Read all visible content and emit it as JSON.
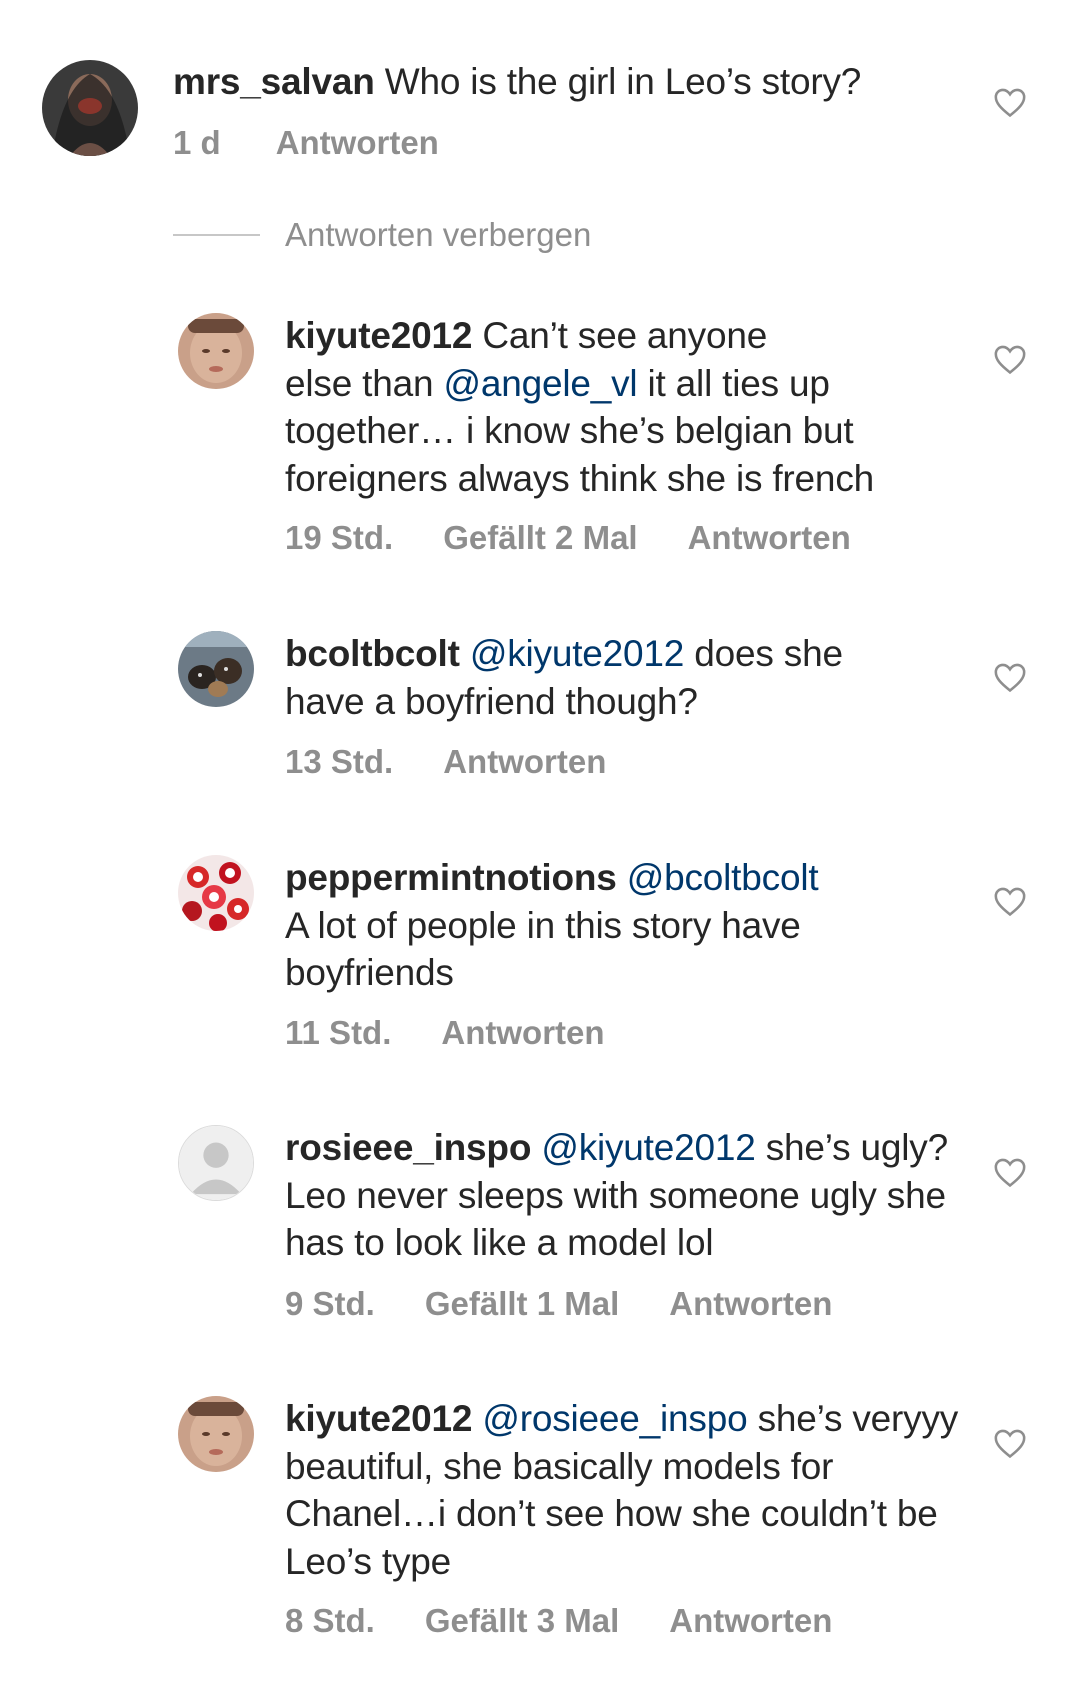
{
  "top_comment": {
    "user": "mrs_salvan",
    "text": " Who is the girl in Leo’s story?",
    "time": "1 d",
    "reply": "Antworten"
  },
  "hide_replies": "Antworten verbergen",
  "replies": [
    {
      "user": "kiyute2012",
      "text_1": " Can’t see anyone",
      "text_2": "else than ",
      "mention": "@angele_vl",
      "text_3": " it all ties up together… i know she’s belgian but foreigners always think she is french",
      "time": "19 Std.",
      "likes": "Gefällt 2 Mal",
      "reply": "Antworten"
    },
    {
      "user": "bcoltbcolt",
      "mention": "@kiyute2012",
      "text": " does she have a boyfriend though?",
      "time": "13 Std.",
      "reply": "Antworten"
    },
    {
      "user": "peppermintnotions",
      "mention": "@bcoltbcolt",
      "text": "A lot of people in this story have boyfriends",
      "time": "11 Std.",
      "reply": "Antworten"
    },
    {
      "user": "rosieee_inspo",
      "mention": "@kiyute2012",
      "text": " she’s ugly? Leo never sleeps with someone ugly she has to look like a model lol",
      "time": "9 Std.",
      "likes": "Gefällt 1 Mal",
      "reply": "Antworten"
    },
    {
      "user": "kiyute2012",
      "mention": "@rosieee_inspo",
      "text": " she’s veryyy beautiful, she basically models for Chanel…i don’t see how she couldn’t be Leo’s type",
      "time": "8 Std.",
      "likes": "Gefällt 3 Mal",
      "reply": "Antworten"
    }
  ],
  "colors": {
    "text": "#262626",
    "muted": "#8e8e8e",
    "mention": "#00376b"
  },
  "icons": [
    "heart-icon",
    "avatar"
  ]
}
